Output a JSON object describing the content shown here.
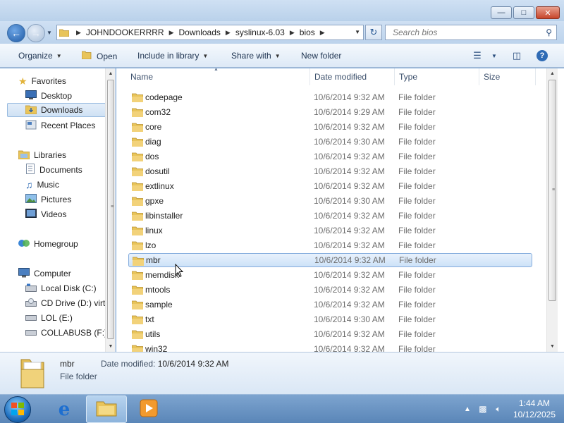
{
  "window": {
    "minimize_icon": "minimize-icon",
    "maximize_icon": "maximize-icon",
    "close_icon": "close-icon"
  },
  "address": {
    "crumbs": [
      "JOHNDOOKERRRR",
      "Downloads",
      "syslinux-6.03",
      "bios"
    ],
    "refresh_icon": "refresh-icon"
  },
  "search": {
    "placeholder": "Search bios"
  },
  "toolbar": {
    "organize": "Organize",
    "open": "Open",
    "include_in_library": "Include in library",
    "share_with": "Share with",
    "new_folder": "New folder"
  },
  "nav": {
    "favorites": "Favorites",
    "desktop": "Desktop",
    "downloads": "Downloads",
    "recent_places": "Recent Places",
    "libraries": "Libraries",
    "documents": "Documents",
    "music": "Music",
    "pictures": "Pictures",
    "videos": "Videos",
    "homegroup": "Homegroup",
    "computer": "Computer",
    "local_disk": "Local Disk (C:)",
    "cd_drive": "CD Drive (D:) virt",
    "lol": "LOL (E:)",
    "collabusb": "COLLABUSB (F:)"
  },
  "columns": {
    "name": "Name",
    "date_modified": "Date modified",
    "type": "Type",
    "size": "Size"
  },
  "files": [
    {
      "name": "codepage",
      "date": "10/6/2014 9:32 AM",
      "type": "File folder"
    },
    {
      "name": "com32",
      "date": "10/6/2014 9:29 AM",
      "type": "File folder"
    },
    {
      "name": "core",
      "date": "10/6/2014 9:32 AM",
      "type": "File folder"
    },
    {
      "name": "diag",
      "date": "10/6/2014 9:30 AM",
      "type": "File folder"
    },
    {
      "name": "dos",
      "date": "10/6/2014 9:32 AM",
      "type": "File folder"
    },
    {
      "name": "dosutil",
      "date": "10/6/2014 9:32 AM",
      "type": "File folder"
    },
    {
      "name": "extlinux",
      "date": "10/6/2014 9:32 AM",
      "type": "File folder"
    },
    {
      "name": "gpxe",
      "date": "10/6/2014 9:30 AM",
      "type": "File folder"
    },
    {
      "name": "libinstaller",
      "date": "10/6/2014 9:32 AM",
      "type": "File folder"
    },
    {
      "name": "linux",
      "date": "10/6/2014 9:32 AM",
      "type": "File folder"
    },
    {
      "name": "lzo",
      "date": "10/6/2014 9:32 AM",
      "type": "File folder"
    },
    {
      "name": "mbr",
      "date": "10/6/2014 9:32 AM",
      "type": "File folder"
    },
    {
      "name": "memdisk",
      "date": "10/6/2014 9:32 AM",
      "type": "File folder"
    },
    {
      "name": "mtools",
      "date": "10/6/2014 9:32 AM",
      "type": "File folder"
    },
    {
      "name": "sample",
      "date": "10/6/2014 9:32 AM",
      "type": "File folder"
    },
    {
      "name": "txt",
      "date": "10/6/2014 9:30 AM",
      "type": "File folder"
    },
    {
      "name": "utils",
      "date": "10/6/2014 9:32 AM",
      "type": "File folder"
    },
    {
      "name": "win32",
      "date": "10/6/2014 9:32 AM",
      "type": "File folder"
    }
  ],
  "selected_file": "mbr",
  "details": {
    "name": "mbr",
    "date_label": "Date modified:",
    "date_value": "10/6/2014 9:32 AM",
    "type": "File folder"
  },
  "taskbar": {
    "time": "1:44 AM",
    "date": "10/12/2025",
    "apps": [
      "ie-icon",
      "explorer-icon",
      "media-player-icon"
    ]
  },
  "colors": {
    "selection": "#cde2f8",
    "accent": "#1f5aa5",
    "taskbar": "#5a86b8"
  }
}
